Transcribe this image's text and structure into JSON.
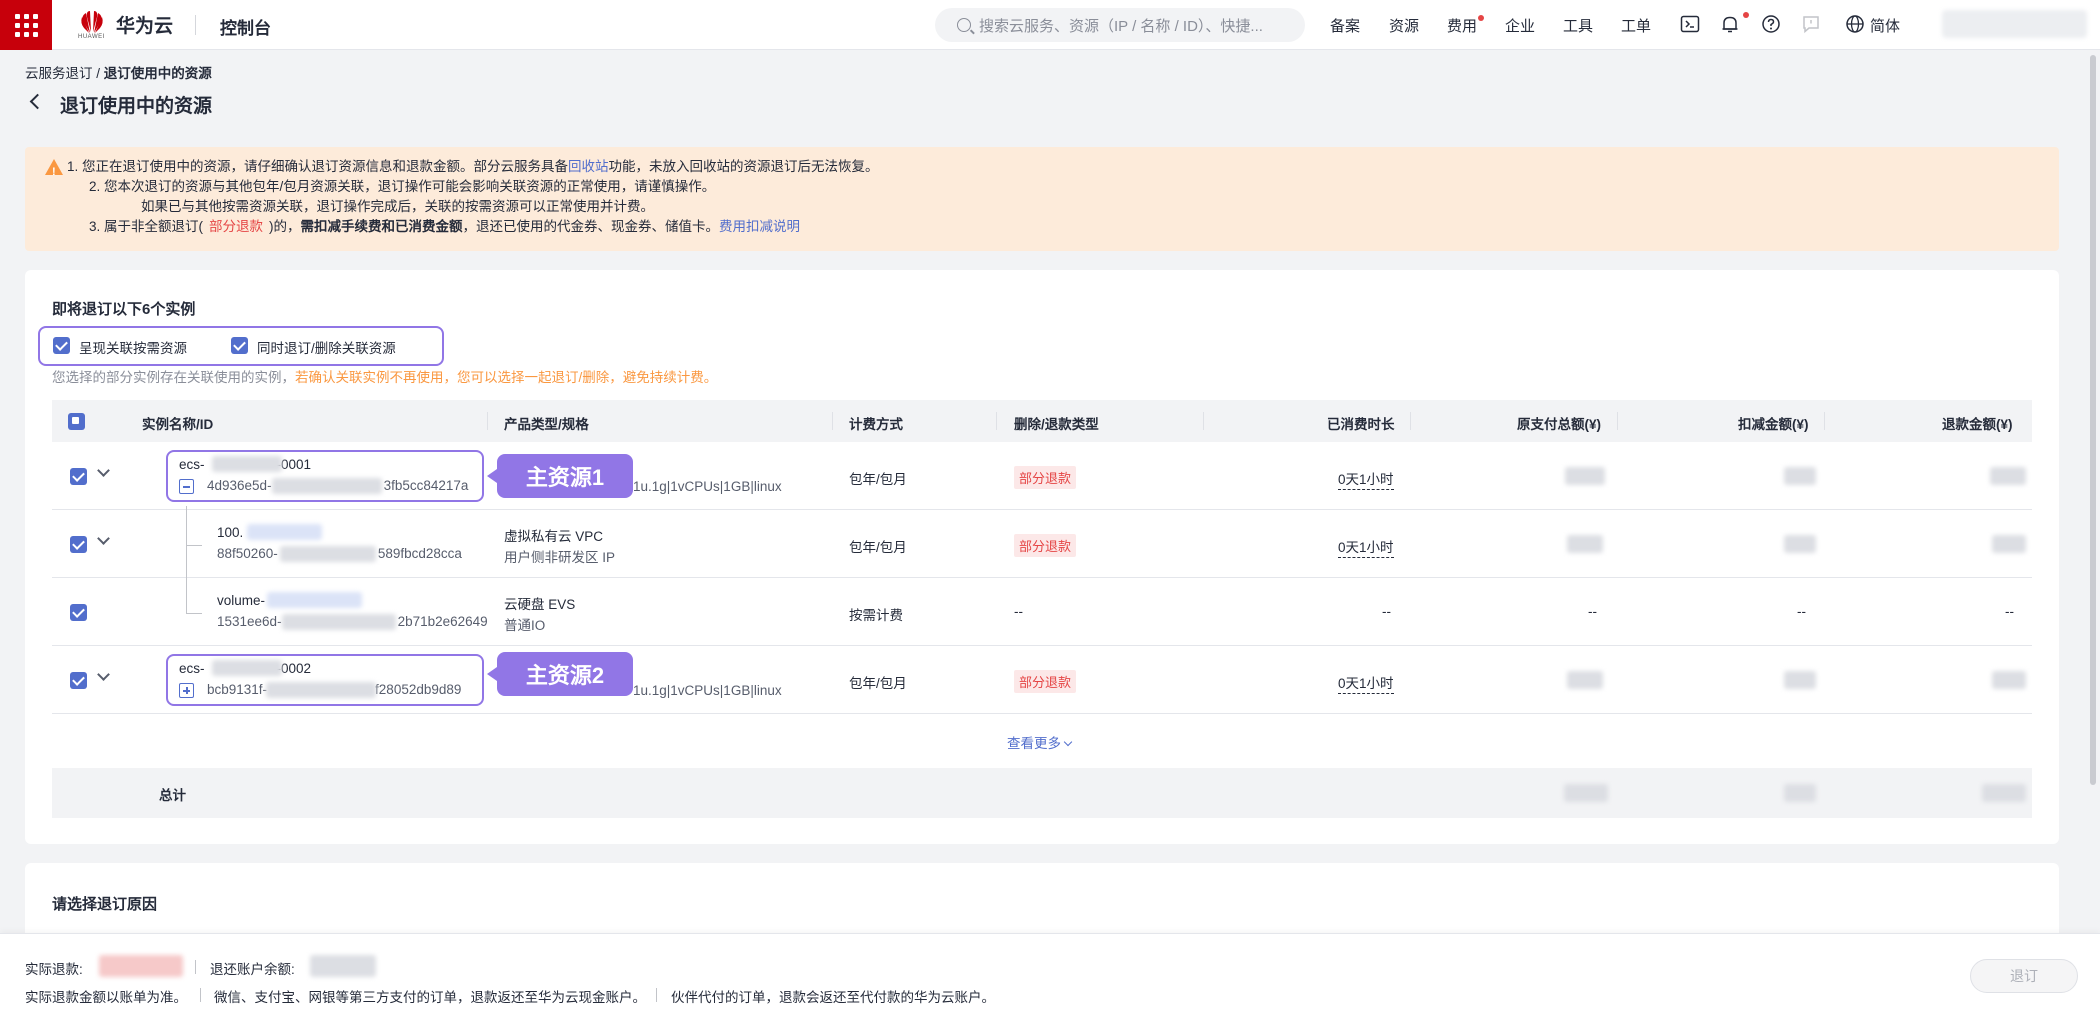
{
  "topbar": {
    "brand": "华为云",
    "brand_small": "HUAWEI",
    "console": "控制台",
    "search_placeholder": "搜索云服务、资源（IP / 名称 / ID）、快捷...",
    "nav": [
      "备案",
      "资源",
      "费用",
      "企业",
      "工具",
      "工单"
    ],
    "lang": "简体",
    "icons": [
      "terminal-icon",
      "bell-icon",
      "help-icon",
      "message-icon",
      "globe-icon"
    ],
    "brand_color": "#c7000b"
  },
  "page": {
    "breadcrumb_parent": "云服务退订",
    "breadcrumb_sep": " / ",
    "breadcrumb_current": "退订使用中的资源",
    "title": "退订使用中的资源"
  },
  "notice": {
    "line1_a": "1. 您正在退订使用中的资源，请仔细确认退订资源信息和退款金额。部分云服务具备",
    "line1_link": "回收站",
    "line1_b": "功能，未放入回收站的资源退订后无法恢复。",
    "line2": "2. 您本次退订的资源与其他包年/包月资源关联，退订操作可能会影响关联资源的正常使用，请谨慎操作。",
    "line2b": "如果已与其他按需资源关联，退订操作完成后，关联的按需资源可以正常使用并计费。",
    "line3_a": "3. 属于非全额退订(",
    "line3_tag": "部分退款",
    "line3_b": ")的，",
    "line3_bold": "需扣减手续费和已消费金额",
    "line3_c": "，退还已使用的代金券、现金券、储值卡。",
    "line3_link": "费用扣减说明"
  },
  "instances": {
    "title": "即将退订以下6个实例",
    "option1": "呈现关联按需资源",
    "option2": "同时退订/删除关联资源",
    "hint_a": "您选择的部分实例存在关联使用的实例，",
    "hint_b": "若确认关联实例不再使用，您可以选择一起退订/删除，避免持续计费。",
    "columns": [
      "实例名称/ID",
      "产品类型/规格",
      "计费方式",
      "删除/退款类型",
      "已消费时长",
      "原支付总额(¥)",
      "扣减金额(¥)",
      "退款金额(¥)"
    ],
    "rows": [
      {
        "name_a": "ecs-",
        "name_b": "-0001",
        "id_a": "4d936e5d-",
        "id_b": "3fb5cc84217a",
        "spec": "1u.1g|1vCPUs|1GB|linux",
        "billing": "包年/包月",
        "refund_type": "部分退款",
        "duration": "0天1小时",
        "callout": "主资源1"
      },
      {
        "name_a": "100.",
        "name_b": "",
        "id_a": "88f50260-",
        "id_b": "589fbcd28cca",
        "product": "虚拟私有云 VPC",
        "spec": "用户侧非研发区 IP",
        "billing": "包年/包月",
        "refund_type": "部分退款",
        "duration": "0天1小时"
      },
      {
        "name_a": "volume-",
        "name_b": "",
        "id_a": "1531ee6d-",
        "id_b": "2b71b2e62649",
        "product": "云硬盘 EVS",
        "spec": "普通IO",
        "billing": "按需计费",
        "refund_type": "--",
        "duration": "--",
        "original": "--",
        "deduct": "--",
        "refund": "--"
      },
      {
        "name_a": "ecs-",
        "name_b": "-0002",
        "id_a": "bcb9131f-",
        "id_b": "f28052db9d89",
        "spec": "1u.1g|1vCPUs|1GB|linux",
        "billing": "包年/包月",
        "refund_type": "部分退款",
        "duration": "0天1小时",
        "callout": "主资源2"
      }
    ],
    "more": "查看更多",
    "total_label": "总计"
  },
  "reason": {
    "title": "请选择退订原因"
  },
  "footer": {
    "actual_refund_label": "实际退款:",
    "account_balance_label": "退还账户余额:",
    "note1": "实际退款金额以账单为准。",
    "note2": "微信、支付宝、网银等第三方支付的订单，退款返还至华为云现金账户。",
    "note3": "伙伴代付的订单，退款会返还至代付款的华为云账户。",
    "submit": "退订"
  },
  "colors": {
    "accent": "#526ecc",
    "highlight": "#9176e6",
    "warning_bg": "#fdebda",
    "danger": "#e54545",
    "orange": "#fa9841"
  }
}
